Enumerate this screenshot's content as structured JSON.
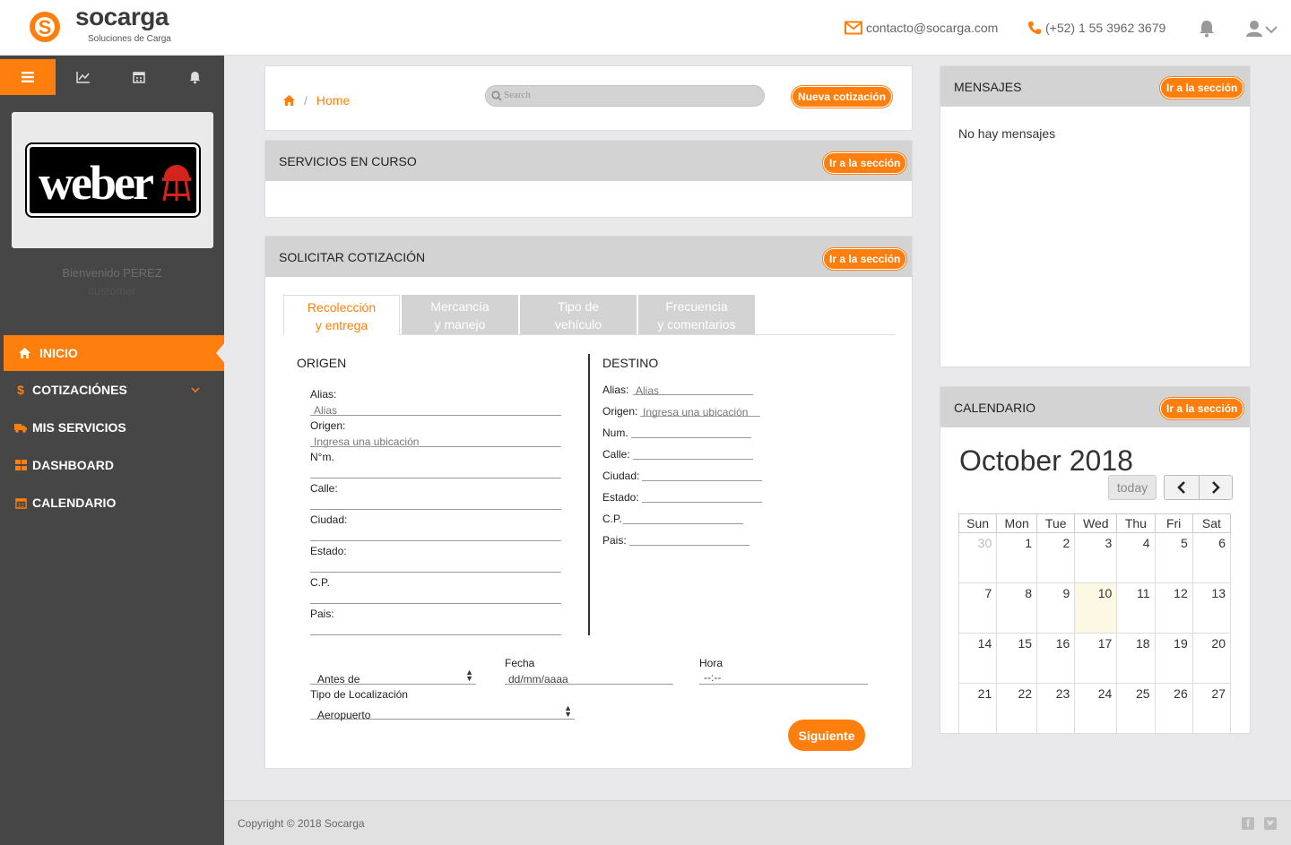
{
  "brand": {
    "name": "socarga",
    "tagline": "Soluciones de Carga",
    "color": "#ff7f0e"
  },
  "header": {
    "email": "contacto@socarga.com",
    "phone": "(+52) 1 55 3962 3679",
    "icons": [
      "envelope-icon",
      "phone-icon",
      "bell-icon",
      "user-icon",
      "chevron-down-icon"
    ]
  },
  "sidebar": {
    "client_logo_text": "weber",
    "welcome": "Bienvenido PEREZ",
    "role": "customer",
    "items": [
      {
        "label": "INICIO",
        "icon": "home-icon",
        "active": true
      },
      {
        "label": "COTIZACIÓNES",
        "icon": "dollar-icon"
      },
      {
        "label": "MIS SERVICIOS",
        "icon": "truck-icon"
      },
      {
        "label": "DASHBOARD",
        "icon": "grid-icon"
      },
      {
        "label": "CALENDARIO",
        "icon": "calendar-icon"
      }
    ]
  },
  "breadcrumb": {
    "home": "Home",
    "separator": "/"
  },
  "search": {
    "placeholder": "Search"
  },
  "nueva_cotizacion": "Nueva cotización",
  "go_section": "Ir a la sección",
  "servicios": {
    "title": "SERVICIOS EN CURSO"
  },
  "cotizacion": {
    "title": "SOLICITAR COTIZACIÓN",
    "tabs": [
      {
        "line1": "Recolección",
        "line2": "y entrega"
      },
      {
        "line1": "Mercancía",
        "line2": "y manejo"
      },
      {
        "line1": "Tipo de",
        "line2": "vehículo"
      },
      {
        "line1": "Frecuencia",
        "line2": "y comentarios"
      }
    ],
    "origen": {
      "title": "ORIGEN",
      "alias": "Alias:",
      "alias_ph": "Alias",
      "origen": "Origen:",
      "origen_ph": "Ingresa una ubicación",
      "num": "N°m.",
      "calle": "Calle:",
      "ciudad": "Ciudad:",
      "estado": "Estado:",
      "cp": "C.P.",
      "pais": "Pais:"
    },
    "destino": {
      "title": "DESTINO",
      "alias": "Alias:",
      "alias_ph": "Alias",
      "origen": "Origen:",
      "origen_ph": "Ingresa una ubicación",
      "num": "Num.",
      "calle": "Calle:",
      "ciudad": "Ciudad:",
      "estado": "Estado:",
      "cp": "C.P.",
      "pais": "Pais:"
    },
    "antes": "Antes de",
    "fecha_label": "Fecha",
    "fecha_ph": "dd/mm/aaaa",
    "hora_label": "Hora",
    "hora_ph": "--:--",
    "tipo_loc_label": "Tipo de Localización",
    "tipo_loc_value": "Aeropuerto",
    "next": "Siguiente"
  },
  "mensajes": {
    "title": "MENSAJES",
    "empty": "No hay mensajes"
  },
  "calendario": {
    "title": "CALENDARIO",
    "month": "October 2018",
    "today": "today",
    "prev": "‹",
    "next": "›",
    "days": [
      "Sun",
      "Mon",
      "Tue",
      "Wed",
      "Thu",
      "Fri",
      "Sat"
    ],
    "weeks": [
      [
        "30",
        "1",
        "2",
        "3",
        "4",
        "5",
        "6"
      ],
      [
        "7",
        "8",
        "9",
        "10",
        "11",
        "12",
        "13"
      ],
      [
        "14",
        "15",
        "16",
        "17",
        "18",
        "19",
        "20"
      ],
      [
        "21",
        "22",
        "23",
        "24",
        "25",
        "26",
        "27"
      ]
    ],
    "today_date": "10"
  },
  "footer": {
    "copyright": "Copyright © 2018 Socarga",
    "icons": [
      "facebook-icon",
      "twitter-icon"
    ]
  }
}
